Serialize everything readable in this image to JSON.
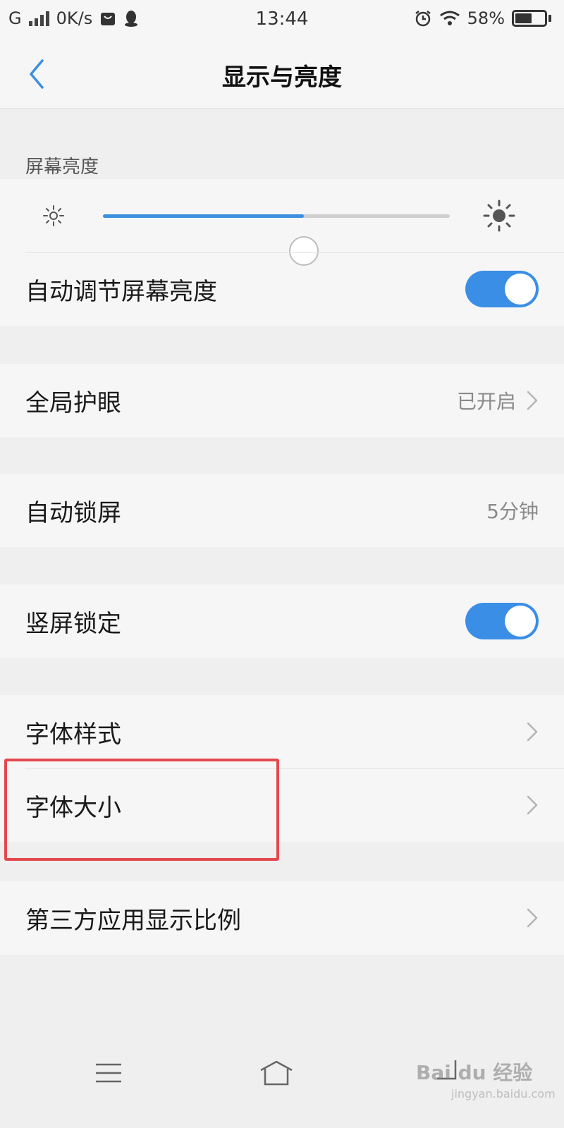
{
  "status_bar": {
    "network": "G",
    "speed": "0K/s",
    "time": "13:44",
    "battery": "58%",
    "battery_level": 0.58,
    "icons": [
      "signal-icon",
      "bag-icon",
      "qq-icon",
      "alarm-icon",
      "wifi-icon",
      "battery-icon"
    ]
  },
  "header": {
    "title": "显示与亮度",
    "back_icon": "chevron-left-icon"
  },
  "brightness": {
    "section_label": "屏幕亮度",
    "level": 0.58,
    "accent_color": "#3d8fe0"
  },
  "rows": {
    "auto_brightness": {
      "label": "自动调节屏幕亮度",
      "enabled": true
    },
    "eye_protection": {
      "label": "全局护眼",
      "value": "已开启"
    },
    "auto_lock": {
      "label": "自动锁屏",
      "value": "5分钟"
    },
    "portrait_lock": {
      "label": "竖屏锁定",
      "enabled": true
    },
    "font_style": {
      "label": "字体样式"
    },
    "font_size": {
      "label": "字体大小"
    },
    "app_ratio": {
      "label": "第三方应用显示比例"
    }
  },
  "highlight_color": "#e4484f",
  "toggle_color": "#3a8ee6",
  "watermark": {
    "text": "Bai du 经验",
    "sub": "jingyan.baidu.com"
  },
  "bottom_nav": [
    "menu-icon",
    "home-icon",
    "back-icon"
  ]
}
